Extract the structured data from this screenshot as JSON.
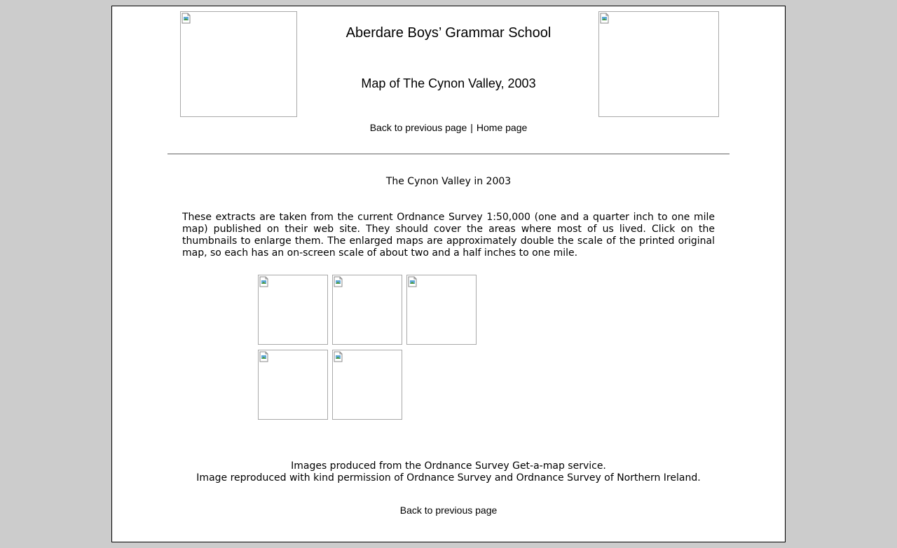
{
  "header": {
    "school_name": "Aberdare Boys’ Grammar School",
    "page_title": "Map of The Cynon Valley, 2003"
  },
  "nav": {
    "back_label": "Back to previous page",
    "separator": "|",
    "home_label": "Home page"
  },
  "main": {
    "heading": "The Cynon Valley in 2003",
    "intro": "These extracts are taken from the current Ordnance Survey 1:50,000 (one and a quarter inch to one mile map) published on their web site. They should cover the areas where most of us lived. Click on the thumbnails to enlarge them. The enlarged maps are approximately double the scale of the printed original map, so each has an on-screen scale of about two and a half inches to one mile.",
    "thumbnail_count": 5
  },
  "credits": {
    "line1": "Images produced from the Ordnance Survey Get-a-map service.",
    "line2": "Image reproduced with kind permission of Ordnance Survey and Ordnance Survey of Northern Ireland."
  },
  "footer_nav": {
    "back_label": "Back to previous page"
  },
  "icons": {
    "broken_image": "broken-image-icon"
  },
  "colors": {
    "window_background": "#cccccc",
    "page_background": "#ffffff",
    "text": "#000000",
    "rule": "#808080",
    "image_border": "#a9a9a9"
  }
}
